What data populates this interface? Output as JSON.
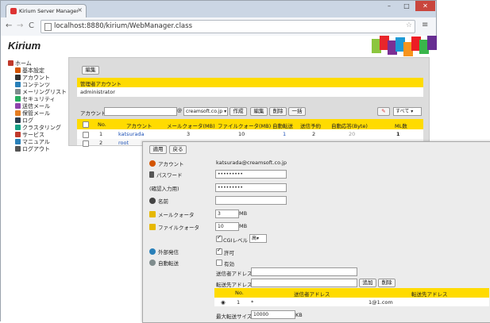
{
  "browser": {
    "tab_title": "Kirium Server Manager",
    "url": "localhost:8880/kirium/WebManager.class",
    "close": "×",
    "back": "←",
    "forward": "→",
    "reload": "C",
    "star": "☆",
    "menu": "≡",
    "minimize": "–",
    "maximize": "□",
    "window_close": "✕"
  },
  "logo": "Kirium",
  "sidebar": {
    "items": [
      {
        "label": "ホーム",
        "icon": "home-icon",
        "color": "#c0392b"
      },
      {
        "label": "基本設定",
        "icon": "settings-icon",
        "color": "#d35400"
      },
      {
        "label": "アカウント",
        "icon": "account-icon",
        "color": "#333333"
      },
      {
        "label": "コンテンツ",
        "icon": "content-icon",
        "color": "#2980b9"
      },
      {
        "label": "メーリングリスト",
        "icon": "mailing-list-icon",
        "color": "#7f8c8d"
      },
      {
        "label": "セキュリティ",
        "icon": "security-icon",
        "color": "#27ae60"
      },
      {
        "label": "送信メール",
        "icon": "sent-mail-icon",
        "color": "#8e44ad"
      },
      {
        "label": "保管メール",
        "icon": "stored-mail-icon",
        "color": "#e67e22"
      },
      {
        "label": "ログ",
        "icon": "log-icon",
        "color": "#2c3e50"
      },
      {
        "label": "クラスタリング",
        "icon": "clustering-icon",
        "color": "#16a085"
      },
      {
        "label": "サービス",
        "icon": "service-icon",
        "color": "#c0392b"
      },
      {
        "label": "マニュアル",
        "icon": "manual-icon",
        "color": "#2980b9"
      },
      {
        "label": "ログアウト",
        "icon": "logout-icon",
        "color": "#555555"
      }
    ]
  },
  "main": {
    "edit_button": "編集",
    "admin_header": "管理者アカウント",
    "admin_value": "administrator",
    "account_label": "アカウント",
    "domain_select": "creamsoft.co.jp",
    "buttons": {
      "create": "作成",
      "edit": "編集",
      "delete": "削除",
      "batch": "一括"
    },
    "filter_select": "すべて",
    "columns": [
      "No.",
      "アカウント",
      "メールクォータ(MB)",
      "ファイルクォータ(MB)",
      "自動転送",
      "送信予約",
      "自動応答(Byte)",
      "ML数"
    ],
    "rows": [
      {
        "no": "1",
        "account": "katsurada",
        "mail_quota": "3",
        "file_quota": "10",
        "forward": "1",
        "scheduled": "2",
        "auto_reply": "20",
        "ml": "1"
      },
      {
        "no": "2",
        "account": "root"
      }
    ]
  },
  "detail": {
    "apply_button": "適用",
    "back_button": "戻る",
    "account_label": "アカウント",
    "account_value": "katsurada@creamsoft.co.jp",
    "password_label": "パスワード",
    "password_value": "•••••••••",
    "password_confirm_label": "(確認入力用)",
    "password_confirm_value": "•••••••••",
    "name_label": "名前",
    "name_value": "",
    "mail_quota_label": "メールクォータ",
    "mail_quota_value": "3",
    "mail_quota_unit": "MB",
    "file_quota_label": "ファイルクォータ",
    "file_quota_value": "10",
    "file_quota_unit": "MB",
    "cgi_label": "CGIレベル",
    "cgi_value": "高",
    "external_label": "外部発信",
    "allow_label": "許可",
    "forward_label": "自動転送",
    "enable_label": "有効",
    "sender_address_label": "送信者アドレス",
    "forward_address_label": "転送先アドレス",
    "add_button": "追加",
    "delete_button": "削除",
    "fwd_columns": [
      "No.",
      "送信者アドレス",
      "転送先アドレス"
    ],
    "fwd_rows": [
      {
        "no": "1",
        "sender": "*",
        "dest": "1@1.com"
      }
    ],
    "max_size_label": "最大転送サイズ",
    "max_size_value": "10000",
    "max_size_unit": "KB"
  },
  "colors": {
    "accent": "#ffdb00",
    "link": "#1a4fb5"
  }
}
